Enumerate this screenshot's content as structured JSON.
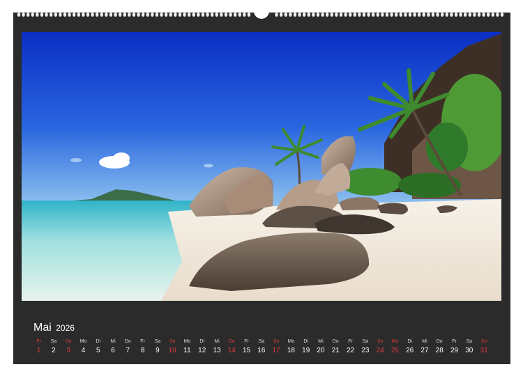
{
  "calendar": {
    "month": "Mai",
    "year": "2026",
    "colors": {
      "background": "#2b2b2b",
      "text": "#ffffff",
      "sunday_holiday": "#e5393a"
    },
    "days": [
      {
        "weekday": "Fr",
        "day": "1",
        "highlight": true
      },
      {
        "weekday": "Sa",
        "day": "2",
        "highlight": false
      },
      {
        "weekday": "So",
        "day": "3",
        "highlight": true
      },
      {
        "weekday": "Mo",
        "day": "4",
        "highlight": false
      },
      {
        "weekday": "Di",
        "day": "5",
        "highlight": false
      },
      {
        "weekday": "Mi",
        "day": "6",
        "highlight": false
      },
      {
        "weekday": "Do",
        "day": "7",
        "highlight": false
      },
      {
        "weekday": "Fr",
        "day": "8",
        "highlight": false
      },
      {
        "weekday": "Sa",
        "day": "9",
        "highlight": false
      },
      {
        "weekday": "So",
        "day": "10",
        "highlight": true
      },
      {
        "weekday": "Mo",
        "day": "11",
        "highlight": false
      },
      {
        "weekday": "Di",
        "day": "12",
        "highlight": false
      },
      {
        "weekday": "Mi",
        "day": "13",
        "highlight": false
      },
      {
        "weekday": "Do",
        "day": "14",
        "highlight": true
      },
      {
        "weekday": "Fr",
        "day": "15",
        "highlight": false
      },
      {
        "weekday": "Sa",
        "day": "16",
        "highlight": false
      },
      {
        "weekday": "So",
        "day": "17",
        "highlight": true
      },
      {
        "weekday": "Mo",
        "day": "18",
        "highlight": false
      },
      {
        "weekday": "Di",
        "day": "19",
        "highlight": false
      },
      {
        "weekday": "Mi",
        "day": "20",
        "highlight": false
      },
      {
        "weekday": "Do",
        "day": "21",
        "highlight": false
      },
      {
        "weekday": "Fr",
        "day": "22",
        "highlight": false
      },
      {
        "weekday": "Sa",
        "day": "23",
        "highlight": false
      },
      {
        "weekday": "So",
        "day": "24",
        "highlight": true
      },
      {
        "weekday": "Mo",
        "day": "25",
        "highlight": true
      },
      {
        "weekday": "Di",
        "day": "26",
        "highlight": false
      },
      {
        "weekday": "Mi",
        "day": "27",
        "highlight": false
      },
      {
        "weekday": "Do",
        "day": "28",
        "highlight": false
      },
      {
        "weekday": "Fr",
        "day": "29",
        "highlight": false
      },
      {
        "weekday": "Sa",
        "day": "30",
        "highlight": false
      },
      {
        "weekday": "So",
        "day": "31",
        "highlight": true
      }
    ]
  },
  "photo": {
    "subject": "tropical-beach",
    "colors": {
      "sky": "#1f4fd6",
      "sea": "#7fd3d8",
      "sand": "#f3ece1",
      "rock": "#6b5a4a",
      "palm": "#3e8a2e"
    }
  }
}
